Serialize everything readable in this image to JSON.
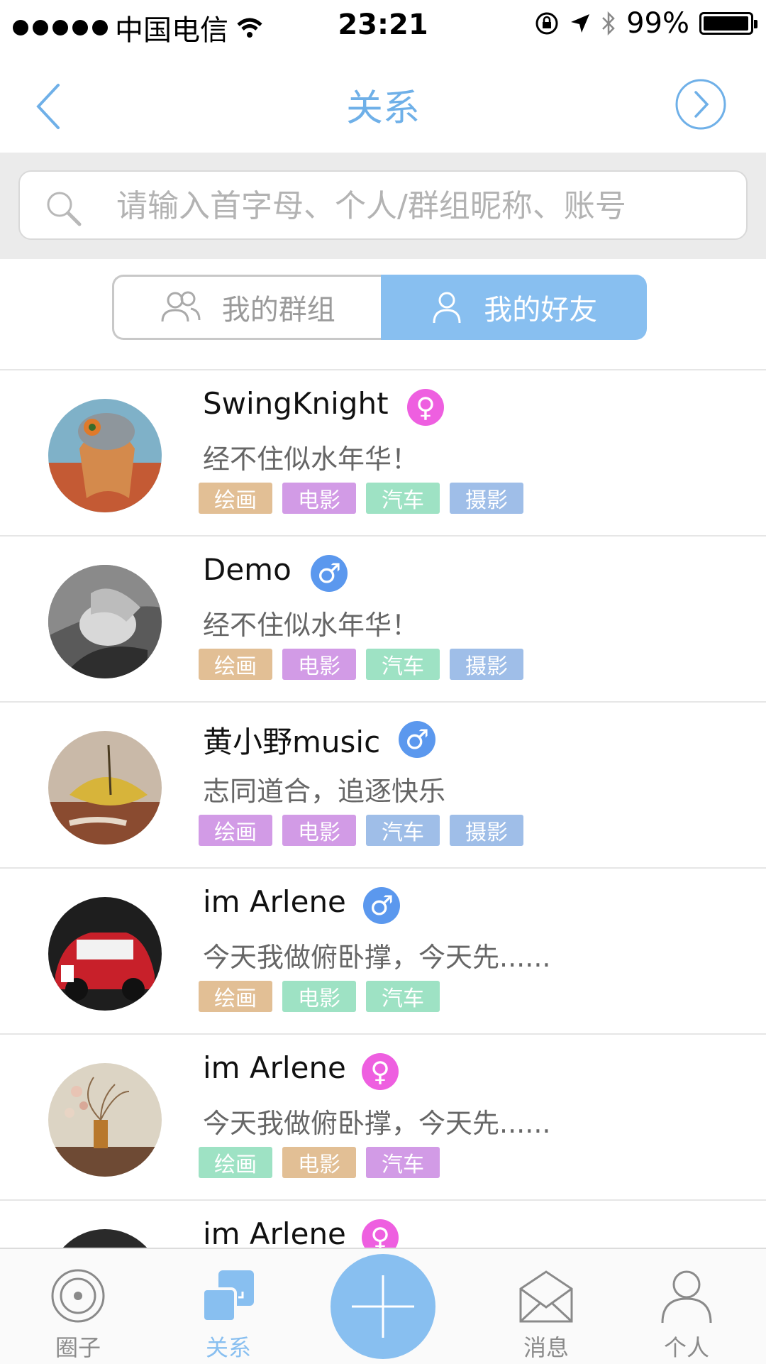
{
  "status_bar": {
    "carrier": "中国电信",
    "time": "23:21",
    "battery": "99%"
  },
  "nav": {
    "title": "关系"
  },
  "search": {
    "placeholder": "请输入首字母、个人/群组昵称、账号"
  },
  "segments": [
    {
      "label": "我的群组",
      "active": false
    },
    {
      "label": "我的好友",
      "active": true
    }
  ],
  "tag_colors": {
    "tan": "#e2bf95",
    "purple": "#d29be6",
    "green": "#9ee2c4",
    "blue": "#9fbee8"
  },
  "gender_colors": {
    "female": "#ee5fe0",
    "male": "#5b98ee"
  },
  "friends": [
    {
      "name": "SwingKnight",
      "gender": "female",
      "gender_symbol": "♀",
      "signature": "经不住似水年华！",
      "tags": [
        {
          "label": "绘画",
          "color": "tan"
        },
        {
          "label": "电影",
          "color": "purple"
        },
        {
          "label": "汽车",
          "color": "green"
        },
        {
          "label": "摄影",
          "color": "blue"
        }
      ]
    },
    {
      "name": "Demo",
      "gender": "male",
      "gender_symbol": "♂",
      "signature": "经不住似水年华！",
      "tags": [
        {
          "label": "绘画",
          "color": "tan"
        },
        {
          "label": "电影",
          "color": "purple"
        },
        {
          "label": "汽车",
          "color": "green"
        },
        {
          "label": "摄影",
          "color": "blue"
        }
      ]
    },
    {
      "name": "黄小野music",
      "gender": "male",
      "gender_symbol": "♂",
      "signature": "志同道合，追逐快乐",
      "tags": [
        {
          "label": "绘画",
          "color": "purple"
        },
        {
          "label": "电影",
          "color": "purple"
        },
        {
          "label": "汽车",
          "color": "blue"
        },
        {
          "label": "摄影",
          "color": "blue"
        }
      ]
    },
    {
      "name": "im Arlene",
      "gender": "male",
      "gender_symbol": "♂",
      "signature": "今天我做俯卧撑，今天先......",
      "tags": [
        {
          "label": "绘画",
          "color": "tan"
        },
        {
          "label": "电影",
          "color": "green"
        },
        {
          "label": "汽车",
          "color": "green"
        }
      ]
    },
    {
      "name": "im Arlene",
      "gender": "female",
      "gender_symbol": "♀",
      "signature": "今天我做俯卧撑，今天先......",
      "tags": [
        {
          "label": "绘画",
          "color": "green"
        },
        {
          "label": "电影",
          "color": "tan"
        },
        {
          "label": "汽车",
          "color": "purple"
        }
      ]
    },
    {
      "name": "im Arlene",
      "gender": "female",
      "gender_symbol": "♀",
      "signature": "",
      "tags": []
    }
  ],
  "tabbar": {
    "tabs": [
      {
        "label": "圈子",
        "icon": "circle-target-icon",
        "active": false
      },
      {
        "label": "关系",
        "icon": "relations-icon",
        "active": true
      },
      {
        "label": "消息",
        "icon": "envelope-icon",
        "active": false
      },
      {
        "label": "个人",
        "icon": "person-icon",
        "active": false
      }
    ],
    "accent": "#88bff0"
  }
}
